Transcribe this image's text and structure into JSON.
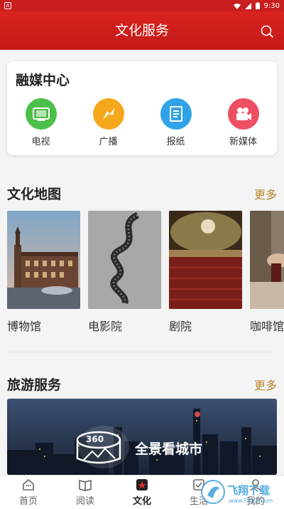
{
  "status": {
    "left_icon": "A",
    "time": "9:30"
  },
  "header": {
    "title": "文化服务"
  },
  "media_center": {
    "title": "融媒中心",
    "items": [
      {
        "label": "电视",
        "color": "#4cbf4a",
        "icon": "tv-icon"
      },
      {
        "label": "广播",
        "color": "#f5a81c",
        "icon": "broadcast-icon"
      },
      {
        "label": "报纸",
        "color": "#2fa3e8",
        "icon": "newspaper-icon"
      },
      {
        "label": "新媒体",
        "color": "#ee4f63",
        "icon": "camera-icon"
      }
    ]
  },
  "culture_map": {
    "title": "文化地图",
    "more": "更多",
    "items": [
      {
        "label": "博物馆"
      },
      {
        "label": "电影院"
      },
      {
        "label": "剧院"
      },
      {
        "label": "咖啡馆"
      }
    ]
  },
  "travel": {
    "title": "旅游服务",
    "more": "更多",
    "banner_badge": "360",
    "banner_text": "全景看城市"
  },
  "tabs": [
    {
      "label": "首页",
      "icon": "home-icon"
    },
    {
      "label": "阅读",
      "icon": "book-icon"
    },
    {
      "label": "文化",
      "icon": "culture-icon",
      "active": true
    },
    {
      "label": "生活",
      "icon": "life-icon"
    },
    {
      "label": "我的",
      "icon": "profile-icon"
    }
  ],
  "watermark": {
    "text": "飞翔下载",
    "url_text": "www.FXXZ.com"
  },
  "colors": {
    "brand_red": "#c81e1e",
    "accent_gold": "#b8862a"
  }
}
